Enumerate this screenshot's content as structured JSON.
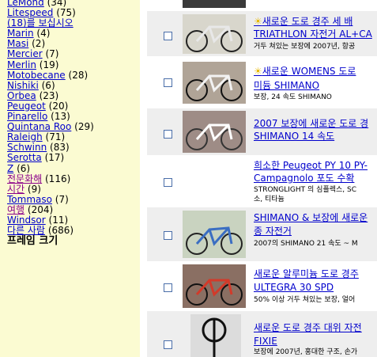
{
  "sidebar": {
    "items": [
      {
        "label": "LeMond",
        "count": "(34)"
      },
      {
        "label": "Litespeed",
        "count": "(75)"
      },
      {
        "label": "(18)를 보십시오",
        "count": ""
      },
      {
        "label": "Marin",
        "count": "(4)"
      },
      {
        "label": "Masi",
        "count": "(2)"
      },
      {
        "label": "Mercier",
        "count": "(7)"
      },
      {
        "label": "Merlin",
        "count": "(19)"
      },
      {
        "label": "Motobecane",
        "count": "(28)"
      },
      {
        "label": "Nishiki",
        "count": "(6)"
      },
      {
        "label": "Orbea",
        "count": "(23)"
      },
      {
        "label": "Peugeot",
        "count": "(20)"
      },
      {
        "label": "Pinarello",
        "count": "(13)"
      },
      {
        "label": "Quintana Roo",
        "count": "(29)"
      },
      {
        "label": "Raleigh",
        "count": "(71)"
      },
      {
        "label": "Schwinn",
        "count": "(83)"
      },
      {
        "label": "Serotta",
        "count": "(17)"
      },
      {
        "label": "Z",
        "count": "(6)"
      },
      {
        "label": "전문화해",
        "count": "(116)"
      },
      {
        "label": "시간",
        "count": "(9)"
      },
      {
        "label": "Tommaso",
        "count": "(7)"
      },
      {
        "label": "여행",
        "count": "(204)"
      },
      {
        "label": "Windsor",
        "count": "(11)"
      },
      {
        "label": "다른 사람",
        "count": "(686)"
      }
    ],
    "heading": "프레임 크기"
  },
  "listings": [
    {
      "title1": "새로운 도로 경주 세 배",
      "title2": "TRIATHLON 자전거 AL+CA",
      "desc": "거두 쳐있는 보장에 2007년, 항공",
      "star": true
    },
    {
      "title1": "새로운 WOMENS 도로",
      "title2": "미듐 SHIMANO",
      "desc": "보장, 24 속도 SHIMANO",
      "star": true
    },
    {
      "title1": "2007 보장에 새로운 도로 경",
      "title2": "SHIMANO 14 속도",
      "desc": "",
      "star": false
    },
    {
      "title1": "희소한 Peugeot PY 10 PY-",
      "title2": "Campagnolo 포도 수확",
      "desc": "STRONGLIGHT 의 심플렉스, SC",
      "desc2": "소, 티타늄",
      "star": false
    },
    {
      "title1": "SHIMANO & 보장에 새로운",
      "title2": "종 자전거",
      "desc": "2007의 SHIMANO 21 속도 ~ M",
      "star": false
    },
    {
      "title1": "새로운 알루미늄 도로 경주",
      "title2": "ULTEGRA 30 SPD",
      "desc": "50% 이상 거두 쳐있는 보장, 얼어",
      "star": false
    },
    {
      "title1": "새로운 도로 경주 대위 자전",
      "title2": "FIXIE",
      "desc": "보장에 2007년, 홍대한 구조, 손가",
      "star": false
    }
  ],
  "colors": {
    "sidebar_bg": "#fbfbd2",
    "link": "#0000cc",
    "visited": "#8b008b",
    "row_shade": "#eeeeee"
  }
}
